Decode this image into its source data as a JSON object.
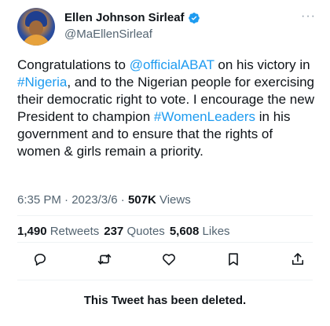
{
  "author": {
    "display_name": "Ellen Johnson Sirleaf",
    "handle": "@MaEllenSirleaf",
    "verified": true,
    "more_label": "···"
  },
  "tweet": {
    "segments": [
      {
        "text": "Congratulations to ",
        "type": "plain"
      },
      {
        "text": "@officialABAT",
        "type": "link"
      },
      {
        "text": " on his victory in ",
        "type": "plain"
      },
      {
        "text": "#Nigeria",
        "type": "link"
      },
      {
        "text": ", and to the Nigerian people for exercising their democratic right to vote. I encourage the new President to champion ",
        "type": "plain"
      },
      {
        "text": "#WomenLeaders",
        "type": "link"
      },
      {
        "text": " in his government and to ensure that the rights of women & girls remain a priority.",
        "type": "plain"
      }
    ],
    "link_color": "#1d9bf0"
  },
  "meta": {
    "time": "6:35 PM",
    "separator": " · ",
    "date": "2023/3/6",
    "views_count": "507K",
    "views_label": " Views"
  },
  "stats": {
    "retweets_count": "1,490",
    "retweets_label": " Retweets",
    "quotes_count": "237",
    "quotes_label": " Quotes",
    "likes_count": "5,608",
    "likes_label": " Likes"
  },
  "actions": [
    "reply-icon",
    "retweet-icon",
    "like-icon",
    "bookmark-icon",
    "share-icon"
  ],
  "notice": {
    "deleted_text": "This Tweet has been deleted."
  },
  "colors": {
    "text": "#0f1419",
    "secondary": "#536471",
    "accent": "#1d9bf0",
    "divider": "#eff3f4"
  }
}
